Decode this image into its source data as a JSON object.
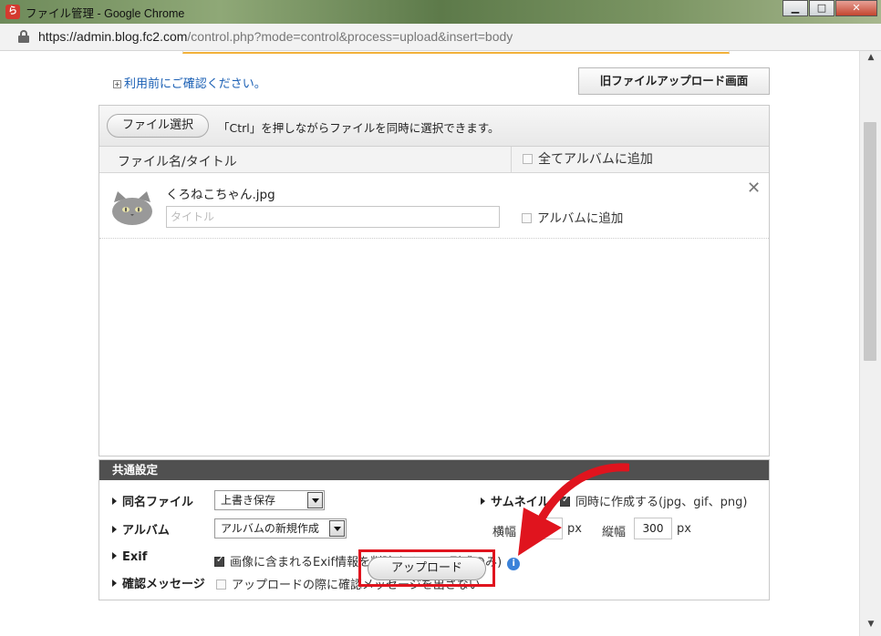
{
  "window": {
    "title": "ファイル管理 - Google Chrome",
    "logo_glyph": "ら",
    "minimize_label": "▁",
    "maximize_label": "□",
    "close_label": "✕"
  },
  "addressbar": {
    "url_host": "https://admin.blog.fc2.com",
    "url_path": "/control.php?mode=control&process=upload&insert=body"
  },
  "page": {
    "notice_link": "利用前にご確認ください。",
    "notice_plus": "+",
    "old_upload_button": "旧ファイルアップロード画面"
  },
  "uploader": {
    "select_button": "ファイル選択",
    "hint": "「Ctrl」を押しながらファイルを同時に選択できます。",
    "col_filename": "ファイル名/タイトル",
    "col_album_all": "全てアルバムに追加",
    "files": [
      {
        "name": "くろねこちゃん.jpg",
        "title_placeholder": "タイトル",
        "album_label": "アルバムに追加",
        "remove": "✕"
      }
    ]
  },
  "settings": {
    "heading": "共通設定",
    "same_name_label": "同名ファイル",
    "same_name_value": "上書き保存",
    "album_label": "アルバム",
    "album_value": "アルバムの新規作成",
    "exif_label": "Exif",
    "exif_option": "画像に含まれるExif情報を削除する(JPEG形式のみ)",
    "exif_checked": true,
    "confirm_label": "確認メッセージ",
    "confirm_option": "アップロードの際に確認メッセージを出さない",
    "confirm_checked": false,
    "thumb_label": "サムネイル",
    "thumb_option": "同時に作成する(jpg、gif、png)",
    "thumb_checked": true,
    "width_label": "横幅",
    "width_value": "300",
    "width_unit": "px",
    "height_label": "縦幅",
    "height_value": "300",
    "height_unit": "px",
    "info_glyph": "i"
  },
  "actions": {
    "upload_button": "アップロード"
  },
  "colors": {
    "highlight": "#e0141e",
    "arrow": "#e0141e",
    "link": "#1a5fb4",
    "settings_header": "#505050"
  }
}
